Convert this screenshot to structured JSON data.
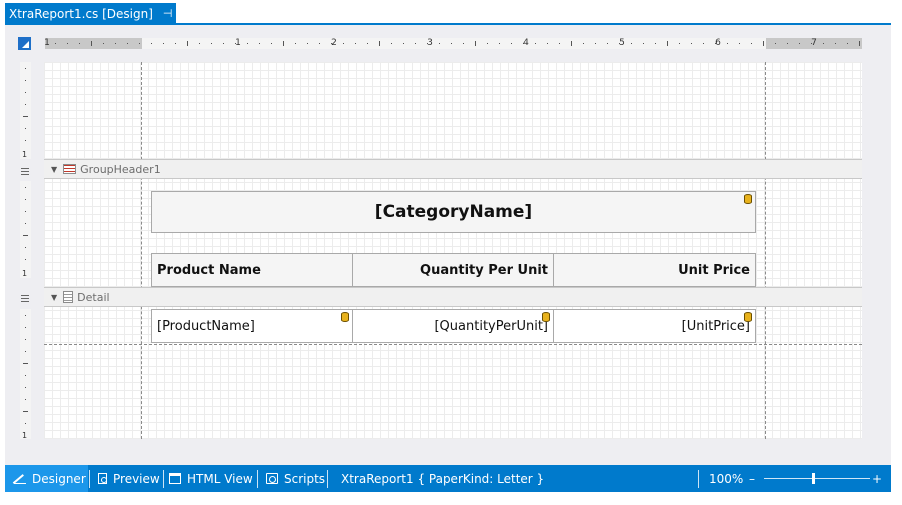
{
  "document_tab": {
    "title": "XtraReport1.cs [Design]",
    "pin_glyph": "⊣",
    "close_glyph": "✕"
  },
  "ruler": {
    "horizontal_labels": [
      "1",
      "1",
      "2",
      "3",
      "4",
      "5",
      "6",
      "7"
    ],
    "vertical_labels": [
      "1",
      "1",
      "1"
    ]
  },
  "bands": {
    "group_header": {
      "label": "GroupHeader1",
      "icon": "group-header-band-icon"
    },
    "detail": {
      "label": "Detail",
      "icon": "detail-band-icon"
    }
  },
  "report": {
    "category_field": "[CategoryName]",
    "headers": [
      "Product Name",
      "Quantity Per Unit",
      "Unit Price"
    ],
    "fields": [
      "[ProductName]",
      "[QuantityPerUnit]",
      "[UnitPrice]"
    ]
  },
  "statusbar": {
    "designer": "Designer",
    "preview": "Preview",
    "html_view": "HTML View",
    "scripts": "Scripts",
    "report_info": "XtraReport1 { PaperKind: Letter }",
    "zoom": "100%",
    "zoom_minus": "–",
    "zoom_plus": "+"
  },
  "colors": {
    "accent": "#007acc",
    "active_tab": "#1c97ea",
    "workspace": "#eeeef2"
  }
}
